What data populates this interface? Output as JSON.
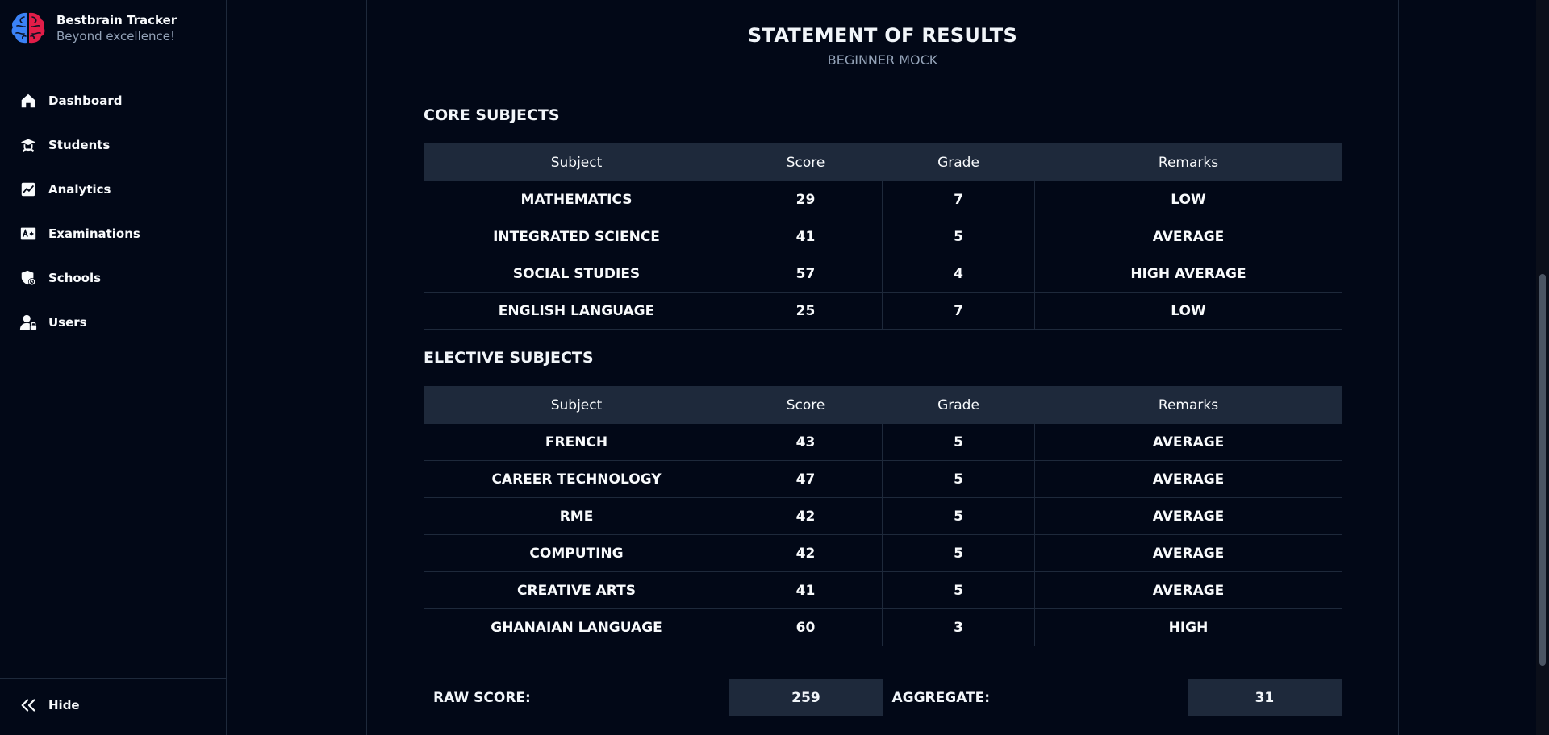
{
  "sidebar": {
    "brand_name": "Bestbrain Tracker",
    "brand_tagline": "Beyond excellence!",
    "items": [
      {
        "label": "Dashboard",
        "icon": "home-icon"
      },
      {
        "label": "Students",
        "icon": "graduation-icon"
      },
      {
        "label": "Analytics",
        "icon": "chart-icon"
      },
      {
        "label": "Examinations",
        "icon": "grade-icon"
      },
      {
        "label": "Schools",
        "icon": "school-shield-icon"
      },
      {
        "label": "Users",
        "icon": "user-lock-icon"
      }
    ],
    "hide_label": "Hide"
  },
  "report": {
    "title": "STATEMENT OF RESULTS",
    "subtitle": "BEGINNER MOCK",
    "columns": [
      "Subject",
      "Score",
      "Grade",
      "Remarks"
    ],
    "core_title": "CORE SUBJECTS",
    "core_rows": [
      [
        "MATHEMATICS",
        "29",
        "7",
        "LOW"
      ],
      [
        "INTEGRATED SCIENCE",
        "41",
        "5",
        "AVERAGE"
      ],
      [
        "SOCIAL STUDIES",
        "57",
        "4",
        "HIGH AVERAGE"
      ],
      [
        "ENGLISH LANGUAGE",
        "25",
        "7",
        "LOW"
      ]
    ],
    "elective_title": "ELECTIVE SUBJECTS",
    "elective_rows": [
      [
        "FRENCH",
        "43",
        "5",
        "AVERAGE"
      ],
      [
        "CAREER TECHNOLOGY",
        "47",
        "5",
        "AVERAGE"
      ],
      [
        "RME",
        "42",
        "5",
        "AVERAGE"
      ],
      [
        "COMPUTING",
        "42",
        "5",
        "AVERAGE"
      ],
      [
        "CREATIVE ARTS",
        "41",
        "5",
        "AVERAGE"
      ],
      [
        "GHANAIAN LANGUAGE",
        "60",
        "3",
        "HIGH"
      ]
    ],
    "raw_score_label": "RAW SCORE:",
    "raw_score_value": "259",
    "aggregate_label": "AGGREGATE:",
    "aggregate_value": "31"
  },
  "colors": {
    "background": "#020817",
    "header_bg": "#1e293b",
    "brain_left": "#3b82f6",
    "brain_right": "#e11d48"
  }
}
